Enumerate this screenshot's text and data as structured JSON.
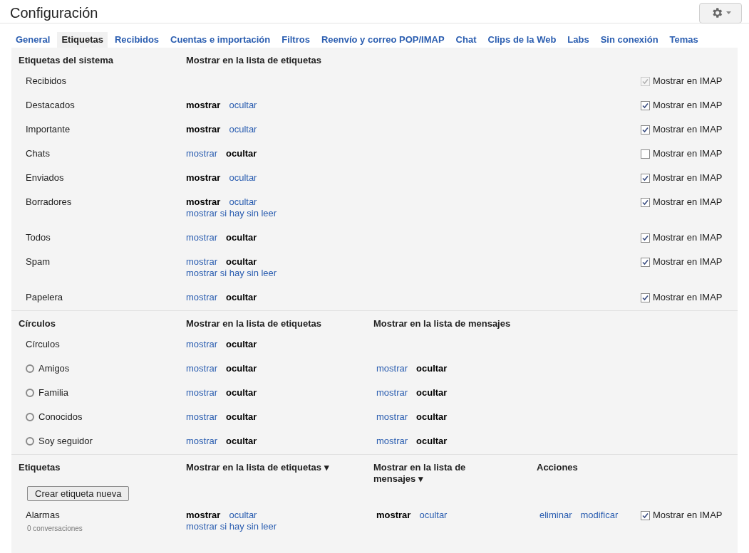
{
  "title": "Configuración",
  "tabs": [
    {
      "label": "General",
      "selected": false
    },
    {
      "label": "Etiquetas",
      "selected": true
    },
    {
      "label": "Recibidos",
      "selected": false
    },
    {
      "label": "Cuentas e importación",
      "selected": false
    },
    {
      "label": "Filtros",
      "selected": false
    },
    {
      "label": "Reenvío y correo POP/IMAP",
      "selected": false
    },
    {
      "label": "Chat",
      "selected": false
    },
    {
      "label": "Clips de la Web",
      "selected": false
    },
    {
      "label": "Labs",
      "selected": false
    },
    {
      "label": "Sin conexión",
      "selected": false
    },
    {
      "label": "Temas",
      "selected": false
    }
  ],
  "system": {
    "heading": "Etiquetas del sistema",
    "column_2": "Mostrar en la lista de etiquetas",
    "rows": [
      {
        "name": "Recibidos",
        "imap": {
          "label": "Mostrar en IMAP",
          "checked": true,
          "disabled": true
        }
      },
      {
        "name": "Destacados",
        "list": {
          "show": "mostrar",
          "hide": "ocultar",
          "shown": true
        },
        "imap": {
          "label": "Mostrar en IMAP",
          "checked": true,
          "disabled": false
        }
      },
      {
        "name": "Importante",
        "list": {
          "show": "mostrar",
          "hide": "ocultar",
          "shown": true
        },
        "imap": {
          "label": "Mostrar en IMAP",
          "checked": true,
          "disabled": false
        }
      },
      {
        "name": "Chats",
        "list": {
          "show": "mostrar",
          "hide": "ocultar",
          "shown": false
        },
        "imap": {
          "label": "Mostrar en IMAP",
          "checked": false,
          "disabled": false
        }
      },
      {
        "name": "Enviados",
        "list": {
          "show": "mostrar",
          "hide": "ocultar",
          "shown": true
        },
        "imap": {
          "label": "Mostrar en IMAP",
          "checked": true,
          "disabled": false
        }
      },
      {
        "name": "Borradores",
        "list": {
          "show": "mostrar",
          "hide": "ocultar",
          "shown": true,
          "unread": "mostrar si hay sin leer"
        },
        "imap": {
          "label": "Mostrar en IMAP",
          "checked": true,
          "disabled": false
        }
      },
      {
        "name": "Todos",
        "list": {
          "show": "mostrar",
          "hide": "ocultar",
          "shown": false
        },
        "imap": {
          "label": "Mostrar en IMAP",
          "checked": true,
          "disabled": false
        }
      },
      {
        "name": "Spam",
        "list": {
          "show": "mostrar",
          "hide": "ocultar",
          "shown": false,
          "unread": "mostrar si hay sin leer"
        },
        "imap": {
          "label": "Mostrar en IMAP",
          "checked": true,
          "disabled": false
        }
      },
      {
        "name": "Papelera",
        "list": {
          "show": "mostrar",
          "hide": "ocultar",
          "shown": false
        },
        "imap": {
          "label": "Mostrar en IMAP",
          "checked": true,
          "disabled": false
        }
      }
    ]
  },
  "circles": {
    "heading": "Círculos",
    "column_2": "Mostrar en la lista de etiquetas",
    "column_3": "Mostrar en la lista de mensajes",
    "rows": [
      {
        "name": "Círculos",
        "kind": "group",
        "list": {
          "show": "mostrar",
          "hide": "ocultar",
          "shown": false
        }
      },
      {
        "name": "Amigos",
        "kind": "circle",
        "list": {
          "show": "mostrar",
          "hide": "ocultar",
          "shown": false
        },
        "messages": {
          "show": "mostrar",
          "hide": "ocultar",
          "shown": false
        }
      },
      {
        "name": "Familia",
        "kind": "circle",
        "list": {
          "show": "mostrar",
          "hide": "ocultar",
          "shown": false
        },
        "messages": {
          "show": "mostrar",
          "hide": "ocultar",
          "shown": false
        }
      },
      {
        "name": "Conocidos",
        "kind": "circle",
        "list": {
          "show": "mostrar",
          "hide": "ocultar",
          "shown": false
        },
        "messages": {
          "show": "mostrar",
          "hide": "ocultar",
          "shown": false
        }
      },
      {
        "name": "Soy seguidor",
        "kind": "circle",
        "list": {
          "show": "mostrar",
          "hide": "ocultar",
          "shown": false
        },
        "messages": {
          "show": "mostrar",
          "hide": "ocultar",
          "shown": false
        }
      }
    ]
  },
  "labels": {
    "heading": "Etiquetas",
    "column_2": "Mostrar en la lista de etiquetas ▾",
    "column_3": "Mostrar en la lista de mensajes ▾",
    "column_4": "Acciones",
    "create_button": "Crear etiqueta nueva",
    "rows": [
      {
        "name": "Alarmas",
        "count": "0 conversaciones",
        "list": {
          "show": "mostrar",
          "hide": "ocultar",
          "shown": true,
          "unread": "mostrar si hay sin leer"
        },
        "messages": {
          "show": "mostrar",
          "hide": "ocultar",
          "shown": true
        },
        "actions": [
          "eliminar",
          "modificar"
        ],
        "imap": {
          "label": "Mostrar en IMAP",
          "checked": true,
          "disabled": false
        }
      }
    ]
  }
}
